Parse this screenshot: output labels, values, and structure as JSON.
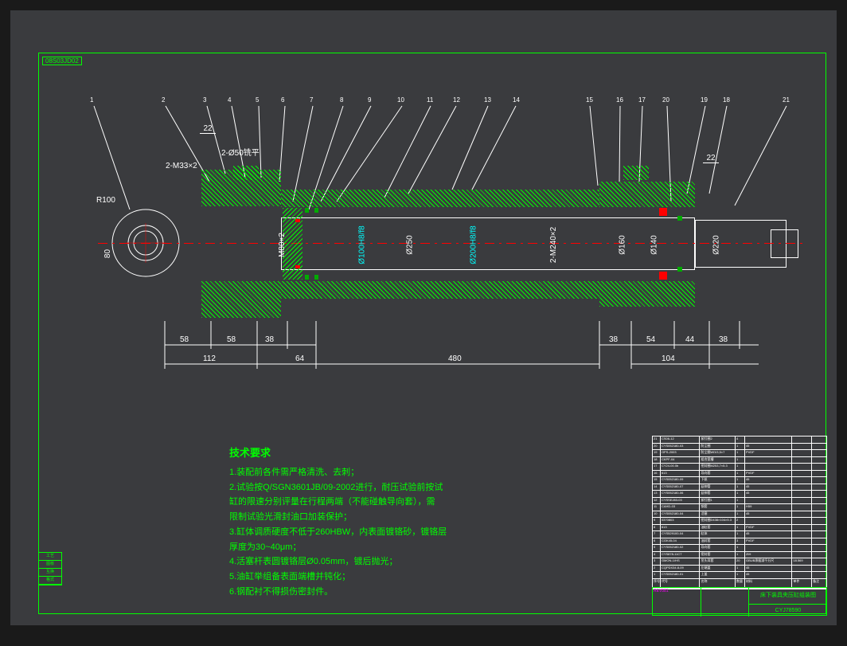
{
  "corner_label": "08S03JD02",
  "balloons": [
    "1",
    "2",
    "3",
    "4",
    "5",
    "6",
    "7",
    "8",
    "9",
    "10",
    "11",
    "12",
    "13",
    "14",
    "15",
    "16",
    "17",
    "20",
    "19",
    "18",
    "21"
  ],
  "balloon_right": "22",
  "balloon_left": "22",
  "annotations": {
    "thread_left": "2-M33×2",
    "planarity": "2-Ø50铣平",
    "radius": "R100",
    "eye_dim": "80"
  },
  "diameters": {
    "d1": "M80×2",
    "d2": "Ø100H8/f8",
    "d3": "Ø250",
    "d4": "Ø200H8/f8",
    "d5": "2-M240×2",
    "d6": "Ø160",
    "d7": "Ø140",
    "d8": "Ø220"
  },
  "dims_h": {
    "d58a": "58",
    "d58b": "58",
    "d38a": "38",
    "d112": "112",
    "d64": "64",
    "d480": "480",
    "d38b": "38",
    "d54": "54",
    "d44": "44",
    "d38c": "38",
    "d104": "104"
  },
  "tech_title": "技术要求",
  "tech_lines": [
    "1.装配前各件需严格清洗、去刺；",
    "2.试验按Q/SGN3601JB/09-2002进行，耐压试验前按试",
    "缸的限速分别评量在行程两端（不能碰触导向套），需",
    "限制试验光滑封油口加装保护；",
    "3.缸体调质硬度不低于260HBW，内表面镀铬砂，镀铬层",
    "厚度为30~40μm；",
    "4.活塞杆表圆镀铬层Ø0.05mm，镀后抛光；",
    "5.油缸举组备表面端槽并钝化；",
    "6.钢配衬不得损伤密封件。"
  ],
  "parts": [
    {
      "n": "21",
      "code": "CS06-12",
      "name": "紧钉圈2",
      "q": "4",
      "mat": "",
      "spec": ""
    },
    {
      "n": "20",
      "code": "CYS052180-03",
      "name": "防尘圈",
      "q": "1",
      "mat": "45",
      "spec": ""
    },
    {
      "n": "19",
      "code": "OPS-2003",
      "name": "防尘圈WDI3,5×7",
      "q": "1",
      "mat": "PVDF",
      "spec": ""
    },
    {
      "n": "18",
      "code": "CKPF-04",
      "name": "组合宽槽",
      "q": "1",
      "mat": "",
      "spec": ""
    },
    {
      "n": "17",
      "code": "CY24-00.0b",
      "name": "密封圈M253,7×5.3",
      "q": "1",
      "mat": "",
      "spec": ""
    },
    {
      "n": "16",
      "code": "613",
      "name": "导向套",
      "q": "1",
      "mat": "PVDF",
      "spec": ""
    },
    {
      "n": "15",
      "code": "CYS052180-09",
      "name": "下驱",
      "q": "1",
      "mat": "45",
      "spec": ""
    },
    {
      "n": "14",
      "code": "CYS052180-07",
      "name": "延伸管",
      "q": "1",
      "mat": "45",
      "spec": ""
    },
    {
      "n": "13",
      "code": "CYS052180-06",
      "name": "延伸套",
      "q": "1",
      "mat": "45",
      "spec": ""
    },
    {
      "n": "12",
      "code": "CYSSEJ83-03",
      "name": "紧钉圈1",
      "q": "1",
      "mat": "",
      "spec": ""
    },
    {
      "n": "11",
      "code": "CAHD-03",
      "name": "钢套",
      "q": "1",
      "mat": "H59",
      "spec": ""
    },
    {
      "n": "10",
      "code": "CYS052180-04",
      "name": "活塞",
      "q": "1",
      "mat": "45",
      "spec": ""
    },
    {
      "n": "9",
      "code": "0370803",
      "name": "密封圈D438×104×5.3",
      "q": "2",
      "mat": "",
      "spec": ""
    },
    {
      "n": "8",
      "code": "613",
      "name": "油缸套",
      "q": "1",
      "mat": "PVDF",
      "spec": ""
    },
    {
      "n": "7",
      "code": "CYS529100-04",
      "name": "缸体",
      "q": "1",
      "mat": "45",
      "spec": ""
    },
    {
      "n": "6",
      "code": "CGK45-04",
      "name": "油封套",
      "q": "3",
      "mat": "PVDF",
      "spec": ""
    },
    {
      "n": "5",
      "code": "CYS052180-02",
      "name": "导向套",
      "q": "1",
      "mat": "",
      "spec": ""
    },
    {
      "n": "4",
      "code": "CYS878-11C7",
      "name": "密封套",
      "q": "1",
      "mat": "ZIH",
      "spec": ""
    },
    {
      "n": "3",
      "code": "GMON-1/HS",
      "name": "吊头耳套",
      "q": "20",
      "mat": "GBUB承插减千分尺",
      "spec": "18.569"
    },
    {
      "n": "2",
      "code": "CQPDX34.8-09",
      "name": "左端盖",
      "q": "1",
      "mat": "45",
      "spec": ""
    },
    {
      "n": "1",
      "code": "CYS052180-01",
      "name": "上盖",
      "q": "1",
      "mat": "45",
      "spec": ""
    }
  ],
  "parts_header": {
    "n": "序号",
    "code": "代号",
    "name": "名称",
    "q": "数量",
    "mat": "材料",
    "spec": "单件",
    "rem": "备注"
  },
  "title_block": {
    "name": "床下装具夹压缸组装图",
    "dwg_no": "CYJ78590",
    "leftlabels": [
      "标记",
      "工艺",
      "阶检",
      "日期",
      "图号"
    ],
    "revlabel": "REV581"
  },
  "left_tabs": [
    "工艺",
    "图核",
    "互换",
    "格式"
  ]
}
